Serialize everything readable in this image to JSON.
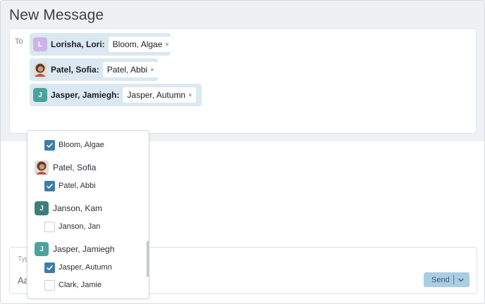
{
  "title": "New Message",
  "to_label": "To",
  "recipients": [
    {
      "initial": "L",
      "name": "Lorisha, Lori:",
      "sub": "Bloom, Algae",
      "remove": "×"
    },
    {
      "initial": "",
      "name": "Patel, Sofia:",
      "sub": "Patel, Abbi",
      "remove": "×"
    },
    {
      "initial": "J",
      "name": "Jasper, Jamiegh:",
      "sub": "Jasper, Autumn",
      "remove": "×"
    }
  ],
  "dropdown": {
    "items": [
      {
        "label": "Bloom, Algae",
        "checked": true
      },
      {
        "label": "Patel, Sofia",
        "initial": ""
      },
      {
        "label": "Patel, Abbi",
        "checked": true
      },
      {
        "label": "Janson, Kam",
        "initial": "J"
      },
      {
        "label": "Janson, Jan",
        "checked": false
      },
      {
        "label": "Jasper, Jamiegh",
        "initial": "J"
      },
      {
        "label": "Jasper, Autumn",
        "checked": true
      },
      {
        "label": "Clark, Jamie",
        "checked": false
      }
    ]
  },
  "compose": {
    "hint": "Typ",
    "font_label": "Aa",
    "send_label": "Send"
  },
  "colors": {
    "accent": "#3f7ca8",
    "send_bg": "#a9cde3",
    "chip_bg": "#dbe8f1",
    "avatar_lilac": "#cdb4e6",
    "avatar_teal": "#4aa39d",
    "avatar_darkteal": "#3c7f7a"
  }
}
